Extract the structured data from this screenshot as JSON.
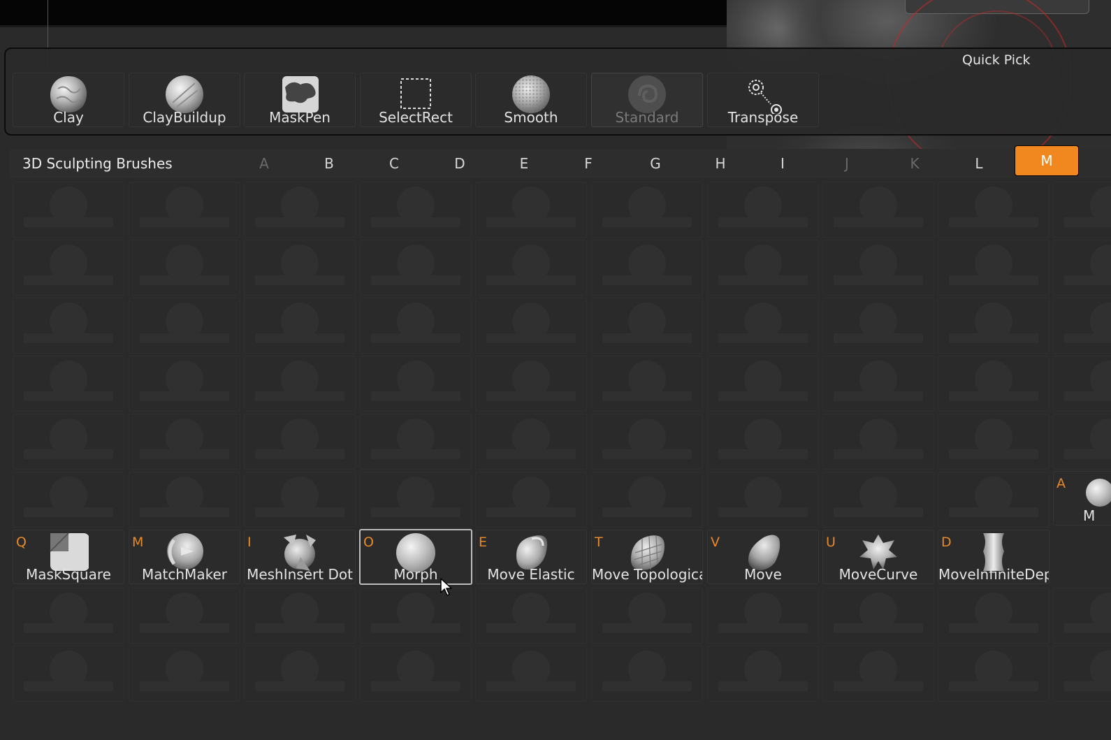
{
  "quick_pick": {
    "title": "Quick Pick",
    "items": [
      {
        "label": "Clay",
        "icon": "clay-brush-icon"
      },
      {
        "label": "ClayBuildup",
        "icon": "claybuildup-brush-icon"
      },
      {
        "label": "MaskPen",
        "icon": "maskpen-brush-icon"
      },
      {
        "label": "SelectRect",
        "icon": "selectrect-brush-icon"
      },
      {
        "label": "Smooth",
        "icon": "smooth-brush-icon"
      },
      {
        "label": "Standard",
        "icon": "standard-brush-icon"
      },
      {
        "label": "Transpose",
        "icon": "transpose-tool-icon"
      }
    ]
  },
  "palette": {
    "title": "3D Sculpting Brushes",
    "letters": [
      "A",
      "B",
      "C",
      "D",
      "E",
      "F",
      "G",
      "H",
      "I",
      "J",
      "K",
      "L",
      "M"
    ],
    "active_letter": "M"
  },
  "m_brushes": [
    {
      "key": "Q",
      "label": "MaskSquare",
      "icon": "masksquare-brush-icon"
    },
    {
      "key": "M",
      "label": "MatchMaker",
      "icon": "matchmaker-brush-icon"
    },
    {
      "key": "I",
      "label": "MeshInsert Dot",
      "icon": "meshinsert-dot-brush-icon"
    },
    {
      "key": "O",
      "label": "Morph",
      "icon": "morph-brush-icon"
    },
    {
      "key": "E",
      "label": "Move Elastic",
      "icon": "move-elastic-brush-icon"
    },
    {
      "key": "T",
      "label": "Move Topologica",
      "icon": "move-topological-brush-icon"
    },
    {
      "key": "V",
      "label": "Move",
      "icon": "move-brush-icon"
    },
    {
      "key": "U",
      "label": "MoveCurve",
      "icon": "movecurve-brush-icon"
    },
    {
      "key": "D",
      "label": "MoveInfiniteDep",
      "icon": "moveinfinitedepth-brush-icon"
    }
  ],
  "partial_slot": {
    "key": "A",
    "label": "M"
  },
  "colors": {
    "accent": "#f0881f",
    "background": "#2a2a2a",
    "key_letter": "#e8892a"
  }
}
